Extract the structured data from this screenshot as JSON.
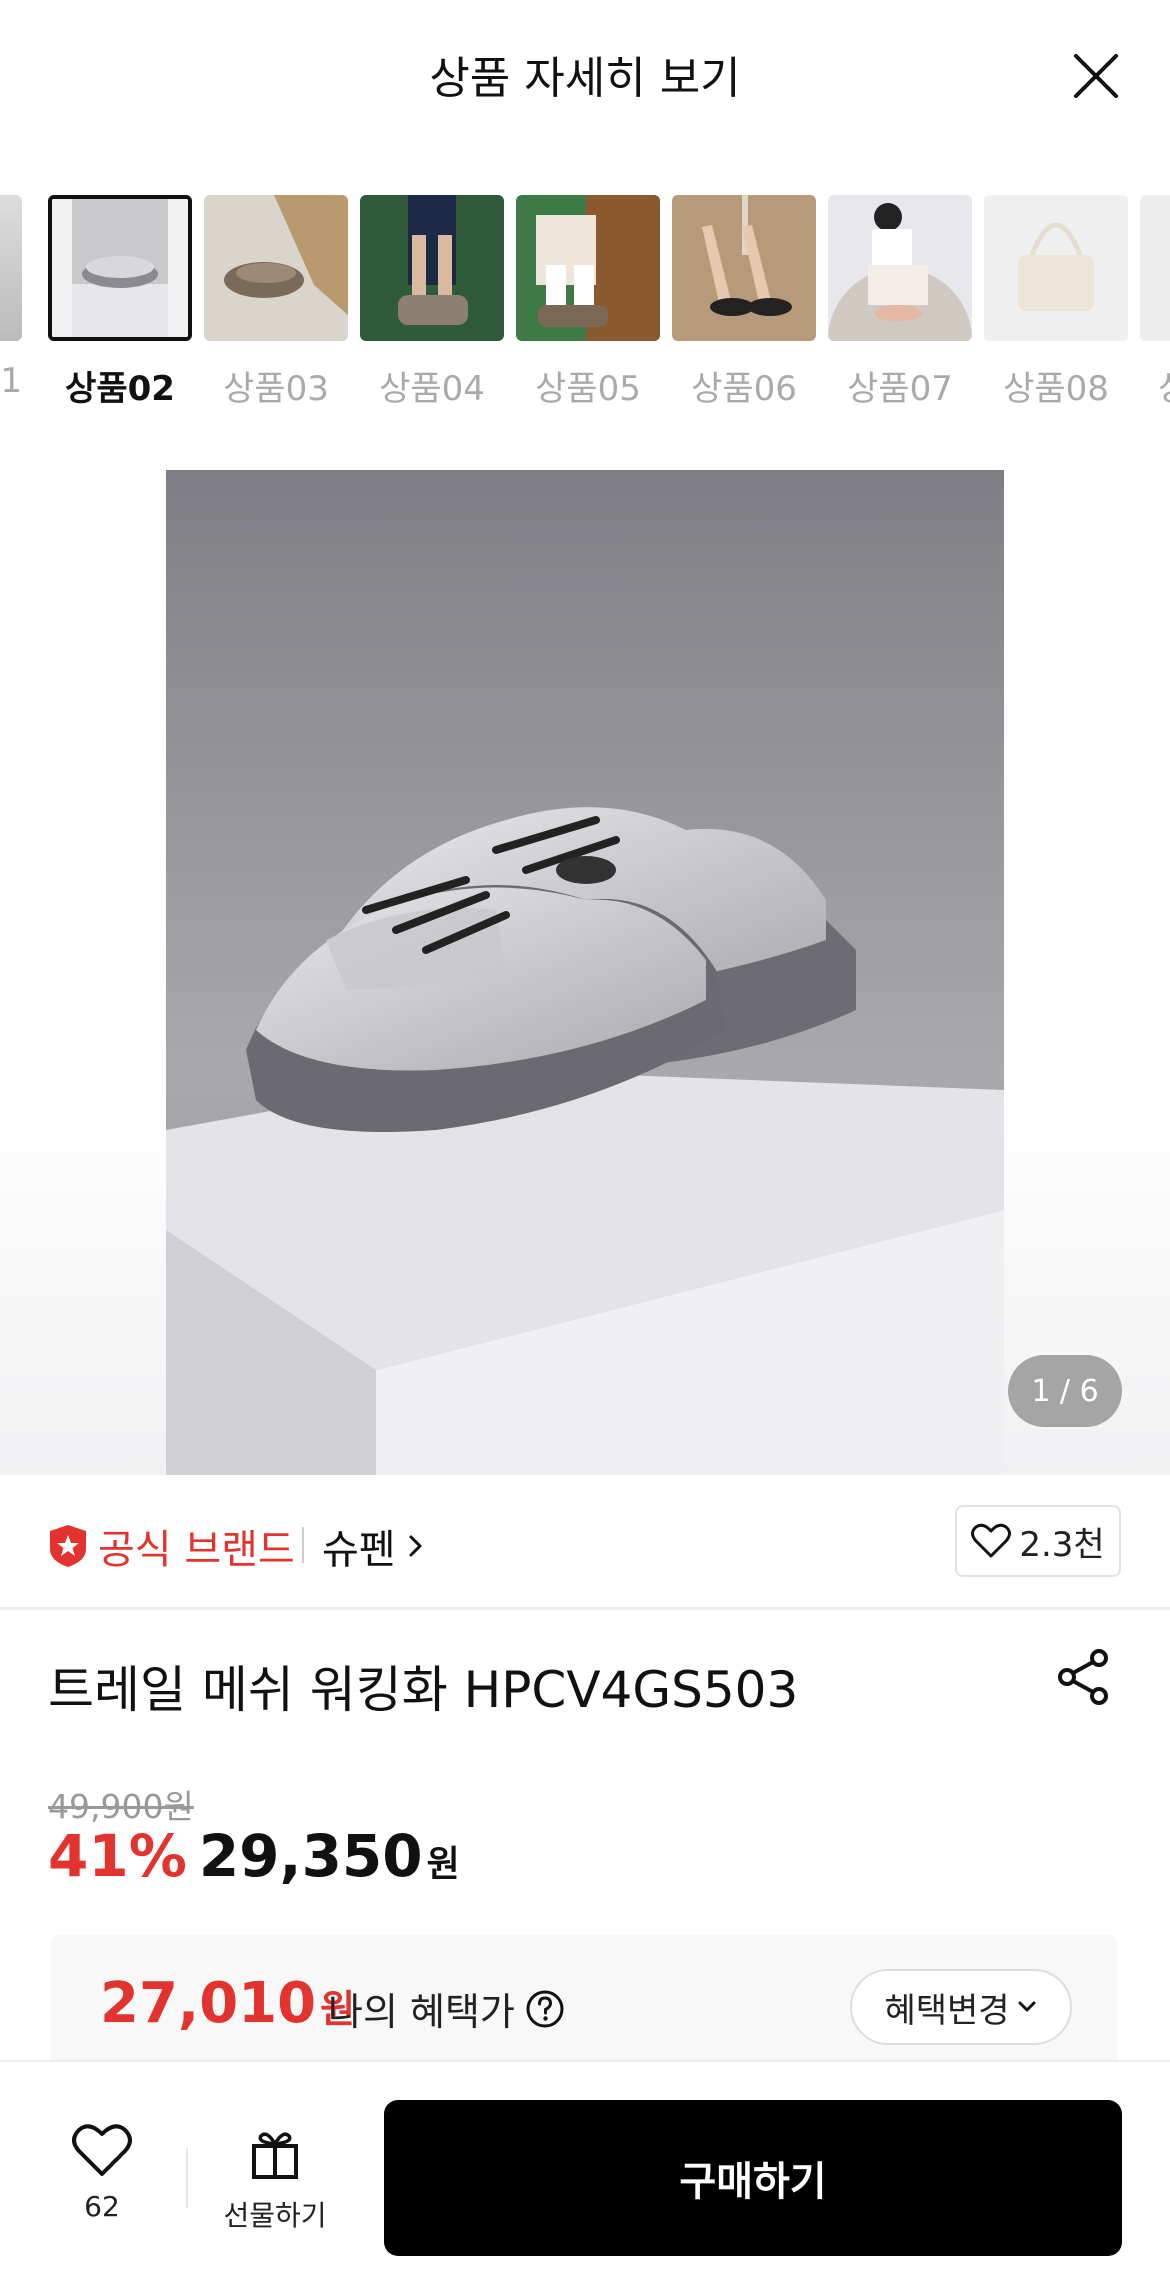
{
  "header": {
    "title": "상품 자세히 보기"
  },
  "thumbnails": [
    {
      "label": "1",
      "active": false
    },
    {
      "label": "상품02",
      "active": true
    },
    {
      "label": "상품03",
      "active": false
    },
    {
      "label": "상품04",
      "active": false
    },
    {
      "label": "상품05",
      "active": false
    },
    {
      "label": "상품06",
      "active": false
    },
    {
      "label": "상품07",
      "active": false
    },
    {
      "label": "상품08",
      "active": false
    },
    {
      "label": "상",
      "active": false
    }
  ],
  "hero": {
    "counter": "1 / 6"
  },
  "brand": {
    "official_label": "공식 브랜드",
    "name": "슈펜",
    "likes": "2.3천"
  },
  "product": {
    "title": "트레일 메쉬 워킹화 HPCV4GS503",
    "original_price": "49,900원",
    "discount": "41%",
    "sale_price": "29,350",
    "currency": "원"
  },
  "benefit": {
    "price": "27,010",
    "currency": "원",
    "label": "나의 혜택가",
    "change_label": "혜택변경"
  },
  "bottom_bar": {
    "wish_count": "62",
    "gift_label": "선물하기",
    "buy_label": "구매하기"
  },
  "colors": {
    "accent_red": "#e2332e",
    "buy_button": "#000000"
  }
}
